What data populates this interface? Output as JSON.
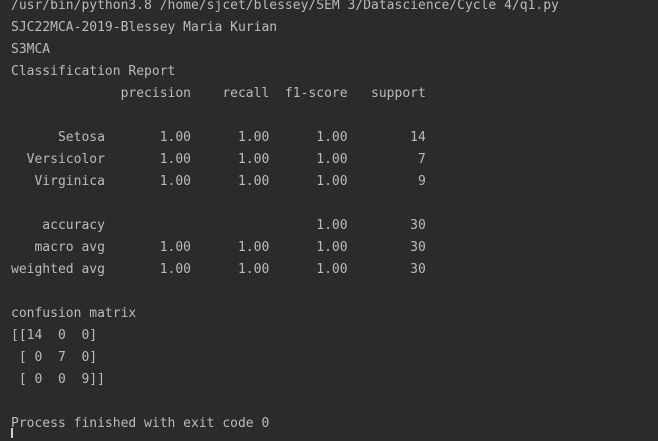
{
  "console": {
    "lines": [
      "/usr/bin/python3.8 /home/sjcet/blessey/SEM 3/Datascience/Cycle 4/q1.py",
      "SJC22MCA-2019-Blessey Maria Kurian",
      "S3MCA",
      "Classification Report",
      "              precision    recall  f1-score   support",
      "",
      "      Setosa       1.00      1.00      1.00        14",
      "  Versicolor       1.00      1.00      1.00         7",
      "   Virginica       1.00      1.00      1.00         9",
      "",
      "    accuracy                           1.00        30",
      "   macro avg       1.00      1.00      1.00        30",
      "weighted avg       1.00      1.00      1.00        30",
      "",
      "confusion matrix",
      "[[14  0  0]",
      " [ 0  7  0]",
      " [ 0  0  9]]",
      "",
      "Process finished with exit code 0"
    ]
  }
}
